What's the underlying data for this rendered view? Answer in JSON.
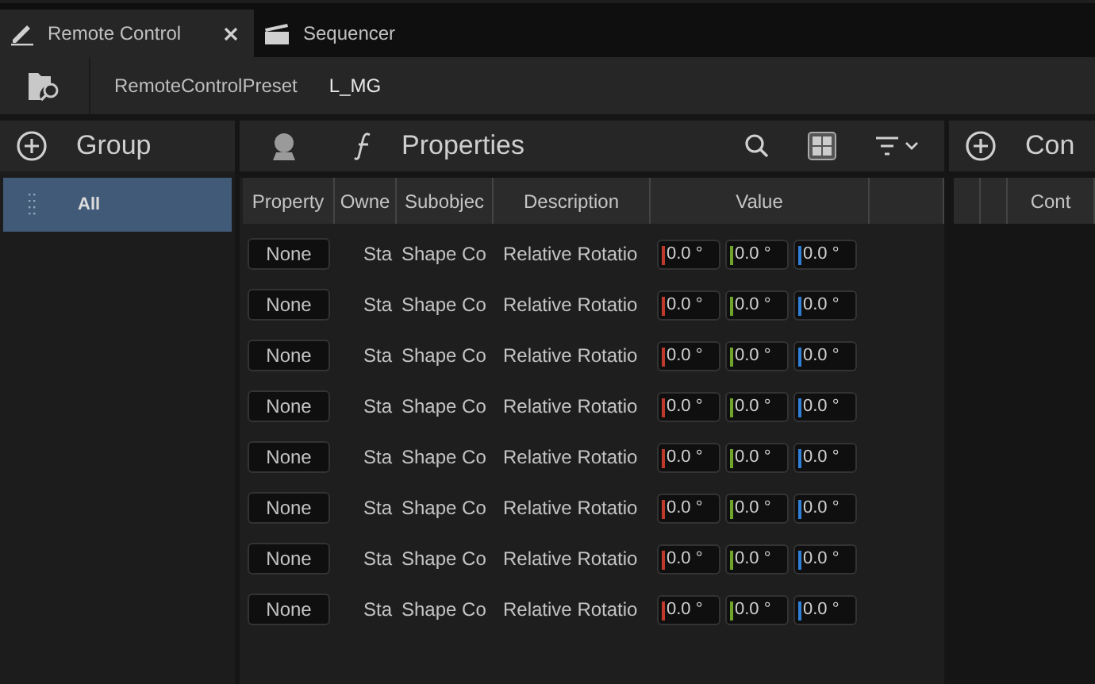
{
  "tabs": [
    {
      "label": "Remote Control",
      "selected": true,
      "closable": true
    },
    {
      "label": "Sequencer",
      "selected": false,
      "closable": false
    }
  ],
  "toolbar": {
    "preset_label": "RemoteControlPreset",
    "preset_name": "L_MG"
  },
  "group_panel": {
    "title": "Group",
    "items": [
      {
        "label": "All",
        "selected": true
      }
    ]
  },
  "properties_panel": {
    "title": "Properties",
    "columns": [
      "Property",
      "Owne",
      "Subobjec",
      "Description",
      "Value"
    ],
    "rows": [
      {
        "property": "None",
        "owner": "Sta",
        "subobject": "Shape Co",
        "description": "Relative Rotatio",
        "values": [
          "0.0 °",
          "0.0 °",
          "0.0 °"
        ]
      },
      {
        "property": "None",
        "owner": "Sta",
        "subobject": "Shape Co",
        "description": "Relative Rotatio",
        "values": [
          "0.0 °",
          "0.0 °",
          "0.0 °"
        ]
      },
      {
        "property": "None",
        "owner": "Sta",
        "subobject": "Shape Co",
        "description": "Relative Rotatio",
        "values": [
          "0.0 °",
          "0.0 °",
          "0.0 °"
        ]
      },
      {
        "property": "None",
        "owner": "Sta",
        "subobject": "Shape Co",
        "description": "Relative Rotatio",
        "values": [
          "0.0 °",
          "0.0 °",
          "0.0 °"
        ]
      },
      {
        "property": "None",
        "owner": "Sta",
        "subobject": "Shape Co",
        "description": "Relative Rotatio",
        "values": [
          "0.0 °",
          "0.0 °",
          "0.0 °"
        ]
      },
      {
        "property": "None",
        "owner": "Sta",
        "subobject": "Shape Co",
        "description": "Relative Rotatio",
        "values": [
          "0.0 °",
          "0.0 °",
          "0.0 °"
        ]
      },
      {
        "property": "None",
        "owner": "Sta",
        "subobject": "Shape Co",
        "description": "Relative Rotatio",
        "values": [
          "0.0 °",
          "0.0 °",
          "0.0 °"
        ]
      },
      {
        "property": "None",
        "owner": "Sta",
        "subobject": "Shape Co",
        "description": "Relative Rotatio",
        "values": [
          "0.0 °",
          "0.0 °",
          "0.0 °"
        ]
      }
    ]
  },
  "controllers_panel": {
    "title": "Con",
    "columns": [
      "Cont"
    ]
  }
}
